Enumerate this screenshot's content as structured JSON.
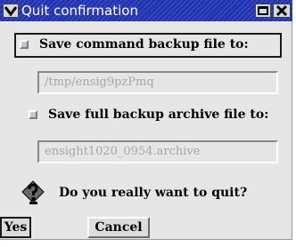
{
  "window": {
    "title": "Quit confirmation"
  },
  "options": {
    "command_backup": {
      "label": "Save command backup file to:",
      "checked": false,
      "path": "/tmp/ensig9pzPmq"
    },
    "archive_backup": {
      "label": "Save full backup archive file to:",
      "checked": false,
      "path": "ensight1020_0954.archive"
    }
  },
  "prompt": {
    "text": "Do you really want to quit?",
    "icon": "question-icon"
  },
  "buttons": {
    "yes": "Yes",
    "cancel": "Cancel"
  },
  "colors": {
    "titlebar": "#1f33b3",
    "background": "#e6e6e6",
    "disabled_text": "#a6a6a6"
  }
}
